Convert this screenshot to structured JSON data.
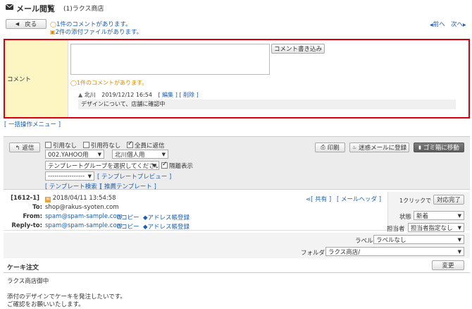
{
  "header": {
    "title": "メール閲覧",
    "subtitle": "(1)ラクス商店"
  },
  "nav": {
    "back_label": "戻る",
    "comment_notice": "1件のコメントがあります。",
    "attachment_notice": "2件の添付ファイルがあります。",
    "prev_label": "前へ",
    "next_label": "次へ"
  },
  "comment_panel": {
    "label": "コメント",
    "input_value": "",
    "write_button": "コメント書き込み",
    "count_notice": "1件のコメントがあります。",
    "entry": {
      "author": "北川",
      "datetime": "2019/12/12 16:54",
      "edit_link": "[ 編集 ]",
      "delete_link": "[ 削除 ]",
      "body": "デザインについて、店舗に確認中"
    }
  },
  "bulk_menu_label": "[ 一括操作メニュー ]",
  "toolbar": {
    "reply_button": "返信",
    "quote_none_label": "引用なし",
    "quote_symbol_label": "引用符なし",
    "reply_all_label": "全員に返信",
    "quote_none_checked": false,
    "quote_symbol_checked": false,
    "reply_all_checked": true,
    "account_select": "002.YAHOO用",
    "signature_select": "北川個人用",
    "template_group_select": "テンプレートグループを選択してください",
    "hide_quote_label": "隔離表示",
    "hide_quote_checked": true,
    "template_select": "-----------------",
    "template_preview_link": "[ テンプレートプレビュー ]",
    "template_search_link": "[ テンプレート検索 ]",
    "recommended_template_link": "[ 推薦テンプレート ]",
    "print_button": "印刷",
    "spam_button": "迷惑メールに登録",
    "trash_button": "ゴミ箱に移動"
  },
  "mail": {
    "id": "[1612-1]",
    "received": "2018/04/11 13:54:58",
    "share_link": "[ 共有 ]",
    "header_link": "[ メールヘッダ ]",
    "to_label": "To:",
    "to_value": "shop@rakus-syoten.com",
    "from_label": "From:",
    "from_value": "spam@spam-sample.com",
    "replyto_label": "Reply-to:",
    "replyto_value": "spam@spam-sample.com",
    "copy_label": "コピー",
    "address_book_label": "アドレス帳登録",
    "subject": "ケーキ注文",
    "change_button": "変更",
    "body_lines": [
      "ラクス商店御中",
      "",
      "添付のデザインでケーキを発注したいです。",
      "ご確認をお願いいたします。"
    ]
  },
  "side": {
    "one_click_label": "1クリックで",
    "complete_button": "対応完了",
    "status_label": "状態",
    "status_value": "新着",
    "assignee_label": "担当者",
    "assignee_value": "担当者指定なし",
    "label_label": "ラベル",
    "label_value": "ラベルなし",
    "folder_label": "フォルダ",
    "folder_value": "ラクス商店/"
  },
  "colors": {
    "link": "#1a5fb4",
    "highlight_border": "#d9000b",
    "comment_label_bg": "#fdf6c2",
    "toolbar_bg": "#ececec",
    "orange": "#d98a00"
  }
}
